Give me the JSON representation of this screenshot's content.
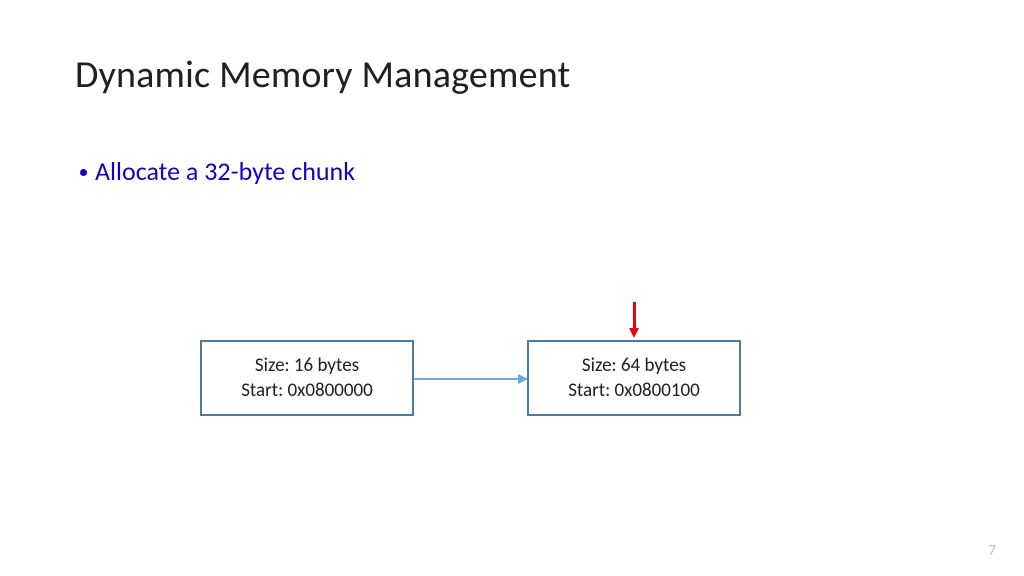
{
  "title": "Dynamic Memory Management",
  "bullet": "Allocate a 32-byte chunk",
  "nodes": [
    {
      "size_line": "Size: 16 bytes",
      "start_line": "Start: 0x0800000"
    },
    {
      "size_line": "Size: 64 bytes",
      "start_line": "Start: 0x0800100"
    }
  ],
  "page_number": "7"
}
